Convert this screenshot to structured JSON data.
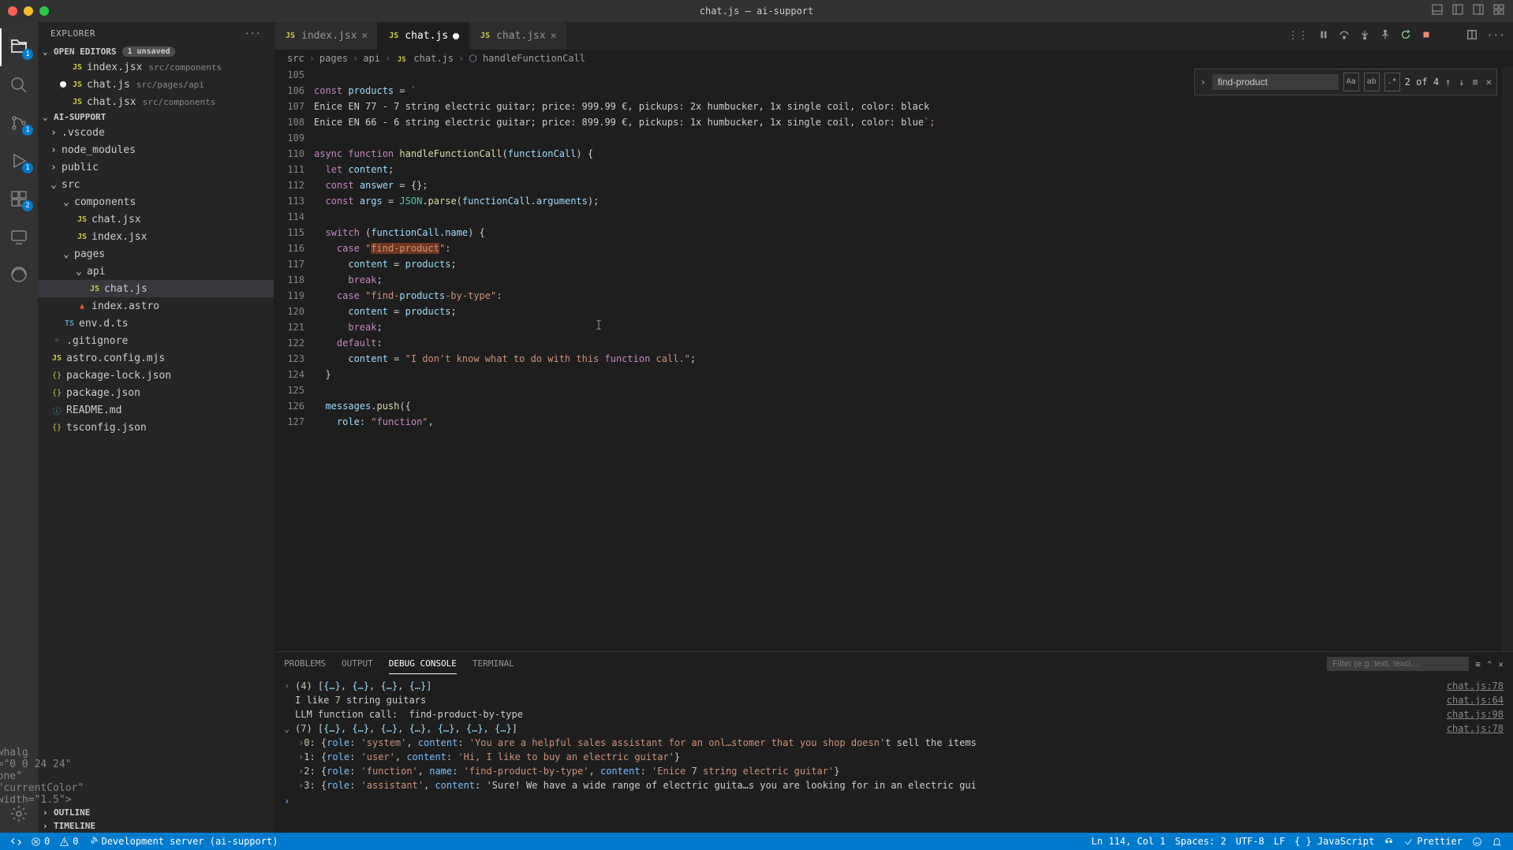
{
  "window": {
    "title": "chat.js — ai-support"
  },
  "sidebar": {
    "header": "EXPLORER",
    "open_editors_label": "OPEN EDITORS",
    "unsaved_label": "1 unsaved",
    "open_editors": [
      {
        "name": "index.jsx",
        "path": "src/components"
      },
      {
        "name": "chat.js",
        "path": "src/pages/api",
        "modified": true
      },
      {
        "name": "chat.jsx",
        "path": "src/components"
      }
    ],
    "project_label": "AI-SUPPORT",
    "tree": [
      {
        "name": ".vscode",
        "kind": "folder",
        "indent": 1,
        "open": false
      },
      {
        "name": "node_modules",
        "kind": "folder",
        "indent": 1,
        "open": false
      },
      {
        "name": "public",
        "kind": "folder",
        "indent": 1,
        "open": false
      },
      {
        "name": "src",
        "kind": "folder",
        "indent": 1,
        "open": true
      },
      {
        "name": "components",
        "kind": "folder",
        "indent": 2,
        "open": true
      },
      {
        "name": "chat.jsx",
        "kind": "file",
        "indent": 3,
        "icon": "js"
      },
      {
        "name": "index.jsx",
        "kind": "file",
        "indent": 3,
        "icon": "js"
      },
      {
        "name": "pages",
        "kind": "folder",
        "indent": 2,
        "open": true
      },
      {
        "name": "api",
        "kind": "folder",
        "indent": 3,
        "open": true
      },
      {
        "name": "chat.js",
        "kind": "file",
        "indent": 4,
        "icon": "js",
        "selected": true
      },
      {
        "name": "index.astro",
        "kind": "file",
        "indent": 3,
        "icon": "astro"
      },
      {
        "name": "env.d.ts",
        "kind": "file",
        "indent": 2,
        "icon": "ts"
      },
      {
        "name": ".gitignore",
        "kind": "file",
        "indent": 1,
        "icon": ""
      },
      {
        "name": "astro.config.mjs",
        "kind": "file",
        "indent": 1,
        "icon": "js"
      },
      {
        "name": "package-lock.json",
        "kind": "file",
        "indent": 1,
        "icon": "json"
      },
      {
        "name": "package.json",
        "kind": "file",
        "indent": 1,
        "icon": "json"
      },
      {
        "name": "README.md",
        "kind": "file",
        "indent": 1,
        "icon": "md"
      },
      {
        "name": "tsconfig.json",
        "kind": "file",
        "indent": 1,
        "icon": "json"
      }
    ],
    "outline_label": "OUTLINE",
    "timeline_label": "TIMELINE"
  },
  "activity_badges": {
    "explorer": "1",
    "scm": "1",
    "debug": "1",
    "ext": "2"
  },
  "tabs": [
    {
      "label": "index.jsx",
      "icon": "js",
      "active": false
    },
    {
      "label": "chat.js",
      "icon": "js",
      "active": true,
      "modified": true
    },
    {
      "label": "chat.jsx",
      "icon": "js",
      "active": false
    }
  ],
  "breadcrumb": [
    "src",
    "pages",
    "api",
    "chat.js",
    "handleFunctionCall"
  ],
  "find": {
    "query": "find-product",
    "count": "2 of 4",
    "aa": "Aa",
    "ab": "ab",
    "re": ".*"
  },
  "code": {
    "first_line": 105,
    "lines": [
      "",
      "const products = `",
      "Enice EN 77 - 7 string electric guitar; price: 999.99 €, pickups: 2x humbucker, 1x single coil, color: black",
      "Enice EN 66 - 6 string electric guitar; price: 899.99 €, pickups: 1x humbucker, 1x single coil, color: blue`;",
      "",
      "async function handleFunctionCall(functionCall) {",
      "  let content;",
      "  const answer = {};",
      "  const args = JSON.parse(functionCall.arguments);",
      "",
      "  switch (functionCall.name) {",
      "    case \"find-product\":",
      "      content = products;",
      "      break;",
      "    case \"find-products-by-type\":",
      "      content = products;",
      "      break;",
      "    default:",
      "      content = \"I don't know what to do with this function call.\";",
      "  }",
      "",
      "  messages.push({",
      "    role: \"function\","
    ]
  },
  "panel": {
    "tabs": [
      "PROBLEMS",
      "OUTPUT",
      "DEBUG CONSOLE",
      "TERMINAL"
    ],
    "active": 2,
    "filter_placeholder": "Filter (e.g. text, !excl…",
    "rows": [
      {
        "chev": ">",
        "text": "(4) [{…}, {…}, {…}, {…}]",
        "src": "chat.js:78"
      },
      {
        "chev": "",
        "text": "I like 7 string guitars",
        "src": "chat.js:64"
      },
      {
        "chev": "",
        "text": "LLM function call:  find-product-by-type",
        "src": "chat.js:98"
      },
      {
        "chev": "v",
        "text": "(7) [{…}, {…}, {…}, {…}, {…}, {…}, {…}]",
        "src": "chat.js:78"
      },
      {
        "chev": ">",
        "text": " 0: {role: 'system', content: 'You are a helpful sales assistant for an onl…stomer that you shop doesn't sell the items",
        "indent": true
      },
      {
        "chev": ">",
        "text": " 1: {role: 'user', content: 'Hi, I like to buy an electric guitar'}",
        "indent": true
      },
      {
        "chev": ">",
        "text": " 2: {role: 'function', name: 'find-product-by-type', content: 'Enice 7 string electric guitar'}",
        "indent": true
      },
      {
        "chev": ">",
        "text": " 3: {role: 'assistant', content: 'Sure! We have a wide range of electric guita…s you are looking for in an electric gui",
        "indent": true
      }
    ]
  },
  "statusbar": {
    "left": [
      {
        "icon": "remote",
        "text": ""
      },
      {
        "icon": "errors",
        "text": "0"
      },
      {
        "icon": "warnings",
        "text": "0"
      },
      {
        "icon": "broadcast",
        "text": "Development server (ai-support)"
      }
    ],
    "right": [
      {
        "text": "Ln 114, Col 1"
      },
      {
        "text": "Spaces: 2"
      },
      {
        "text": "UTF-8"
      },
      {
        "text": "LF"
      },
      {
        "text": "{ } JavaScript"
      },
      {
        "icon": "copilot",
        "text": ""
      },
      {
        "icon": "check",
        "text": "Prettier"
      },
      {
        "icon": "feedback",
        "text": ""
      },
      {
        "icon": "bell",
        "text": ""
      }
    ]
  }
}
